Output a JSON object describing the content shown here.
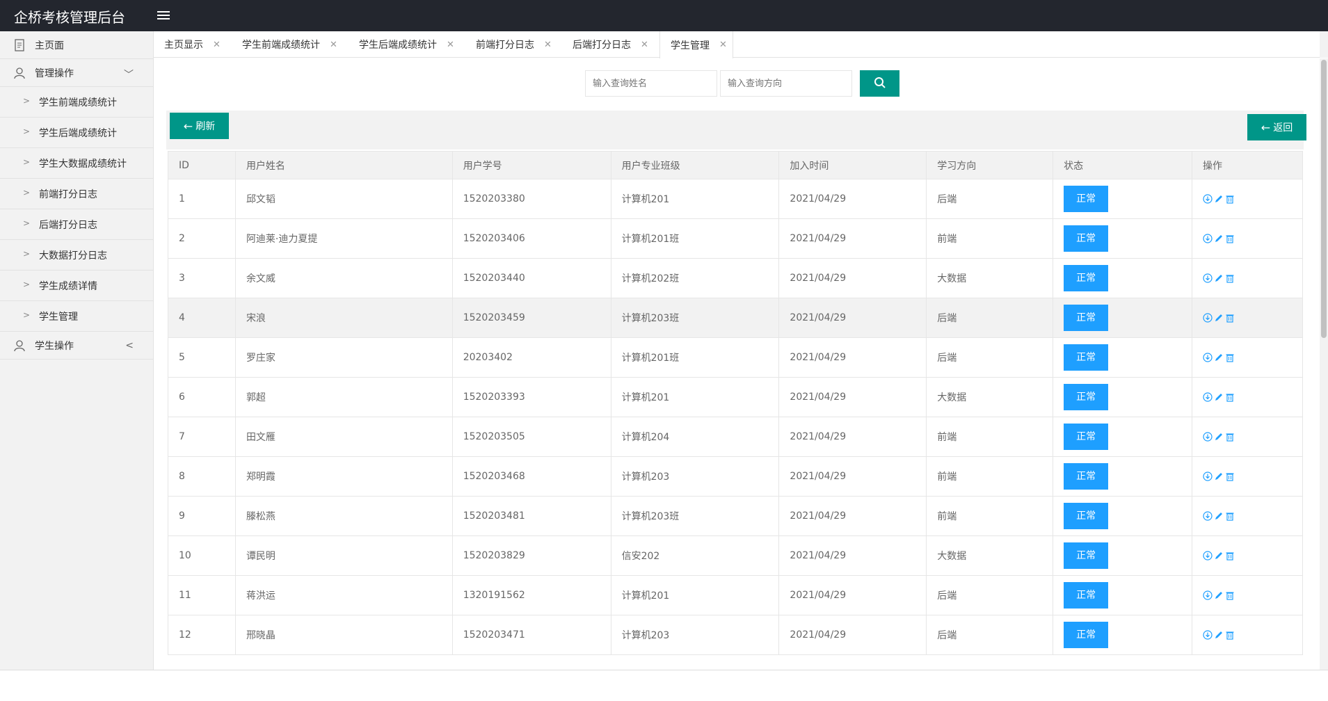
{
  "app": {
    "title": "企桥考核管理后台"
  },
  "sidebar": {
    "home": "主页面",
    "manage": "管理操作",
    "sub_items": [
      {
        "label": "学生前端成绩统计"
      },
      {
        "label": "学生后端成绩统计"
      },
      {
        "label": "学生大数据成绩统计"
      },
      {
        "label": "前端打分日志"
      },
      {
        "label": "后端打分日志"
      },
      {
        "label": "大数据打分日志"
      },
      {
        "label": "学生成绩详情"
      },
      {
        "label": "学生管理"
      }
    ],
    "student_ops": "学生操作"
  },
  "tabs": [
    {
      "label": "主页显示"
    },
    {
      "label": "学生前端成绩统计"
    },
    {
      "label": "学生后端成绩统计"
    },
    {
      "label": "前端打分日志"
    },
    {
      "label": "后端打分日志"
    },
    {
      "label": "学生管理"
    }
  ],
  "search": {
    "name_placeholder": "输入查询姓名",
    "direction_placeholder": "输入查询方向"
  },
  "toolbar": {
    "refresh_label": "刷新",
    "back_label": "返回"
  },
  "table": {
    "columns": [
      "ID",
      "用户姓名",
      "用户学号",
      "用户专业班级",
      "加入时间",
      "学习方向",
      "状态",
      "操作"
    ],
    "rows": [
      {
        "id": "1",
        "name": "邱文韬",
        "sid": "1520203380",
        "cls": "计算机201",
        "date": "2021/04/29",
        "dir": "后端",
        "status": "正常"
      },
      {
        "id": "2",
        "name": "阿迪莱·迪力夏提",
        "sid": "1520203406",
        "cls": "计算机201班",
        "date": "2021/04/29",
        "dir": "前端",
        "status": "正常"
      },
      {
        "id": "3",
        "name": "余文威",
        "sid": "1520203440",
        "cls": "计算机202班",
        "date": "2021/04/29",
        "dir": "大数据",
        "status": "正常"
      },
      {
        "id": "4",
        "name": "宋浪",
        "sid": "1520203459",
        "cls": "计算机203班",
        "date": "2021/04/29",
        "dir": "后端",
        "status": "正常"
      },
      {
        "id": "5",
        "name": "罗庄家",
        "sid": "20203402",
        "cls": "计算机201班",
        "date": "2021/04/29",
        "dir": "后端",
        "status": "正常"
      },
      {
        "id": "6",
        "name": "郭超",
        "sid": "1520203393",
        "cls": "计算机201",
        "date": "2021/04/29",
        "dir": "大数据",
        "status": "正常"
      },
      {
        "id": "7",
        "name": "田文雁",
        "sid": "1520203505",
        "cls": "计算机204",
        "date": "2021/04/29",
        "dir": "前端",
        "status": "正常"
      },
      {
        "id": "8",
        "name": "郑明霞",
        "sid": "1520203468",
        "cls": "计算机203",
        "date": "2021/04/29",
        "dir": "前端",
        "status": "正常"
      },
      {
        "id": "9",
        "name": "滕松燕",
        "sid": "1520203481",
        "cls": "计算机203班",
        "date": "2021/04/29",
        "dir": "前端",
        "status": "正常"
      },
      {
        "id": "10",
        "name": "谭民明",
        "sid": "1520203829",
        "cls": "信安202",
        "date": "2021/04/29",
        "dir": "大数据",
        "status": "正常"
      },
      {
        "id": "11",
        "name": "蒋洪运",
        "sid": "1320191562",
        "cls": "计算机201",
        "date": "2021/04/29",
        "dir": "后端",
        "status": "正常"
      },
      {
        "id": "12",
        "name": "邢晓晶",
        "sid": "1520203471",
        "cls": "计算机203",
        "date": "2021/04/29",
        "dir": "后端",
        "status": "正常"
      }
    ]
  },
  "colors": {
    "topbar": "#23262e",
    "primary": "#009688",
    "status": "#1e9fff",
    "sidebar": "#f2f2f2"
  }
}
